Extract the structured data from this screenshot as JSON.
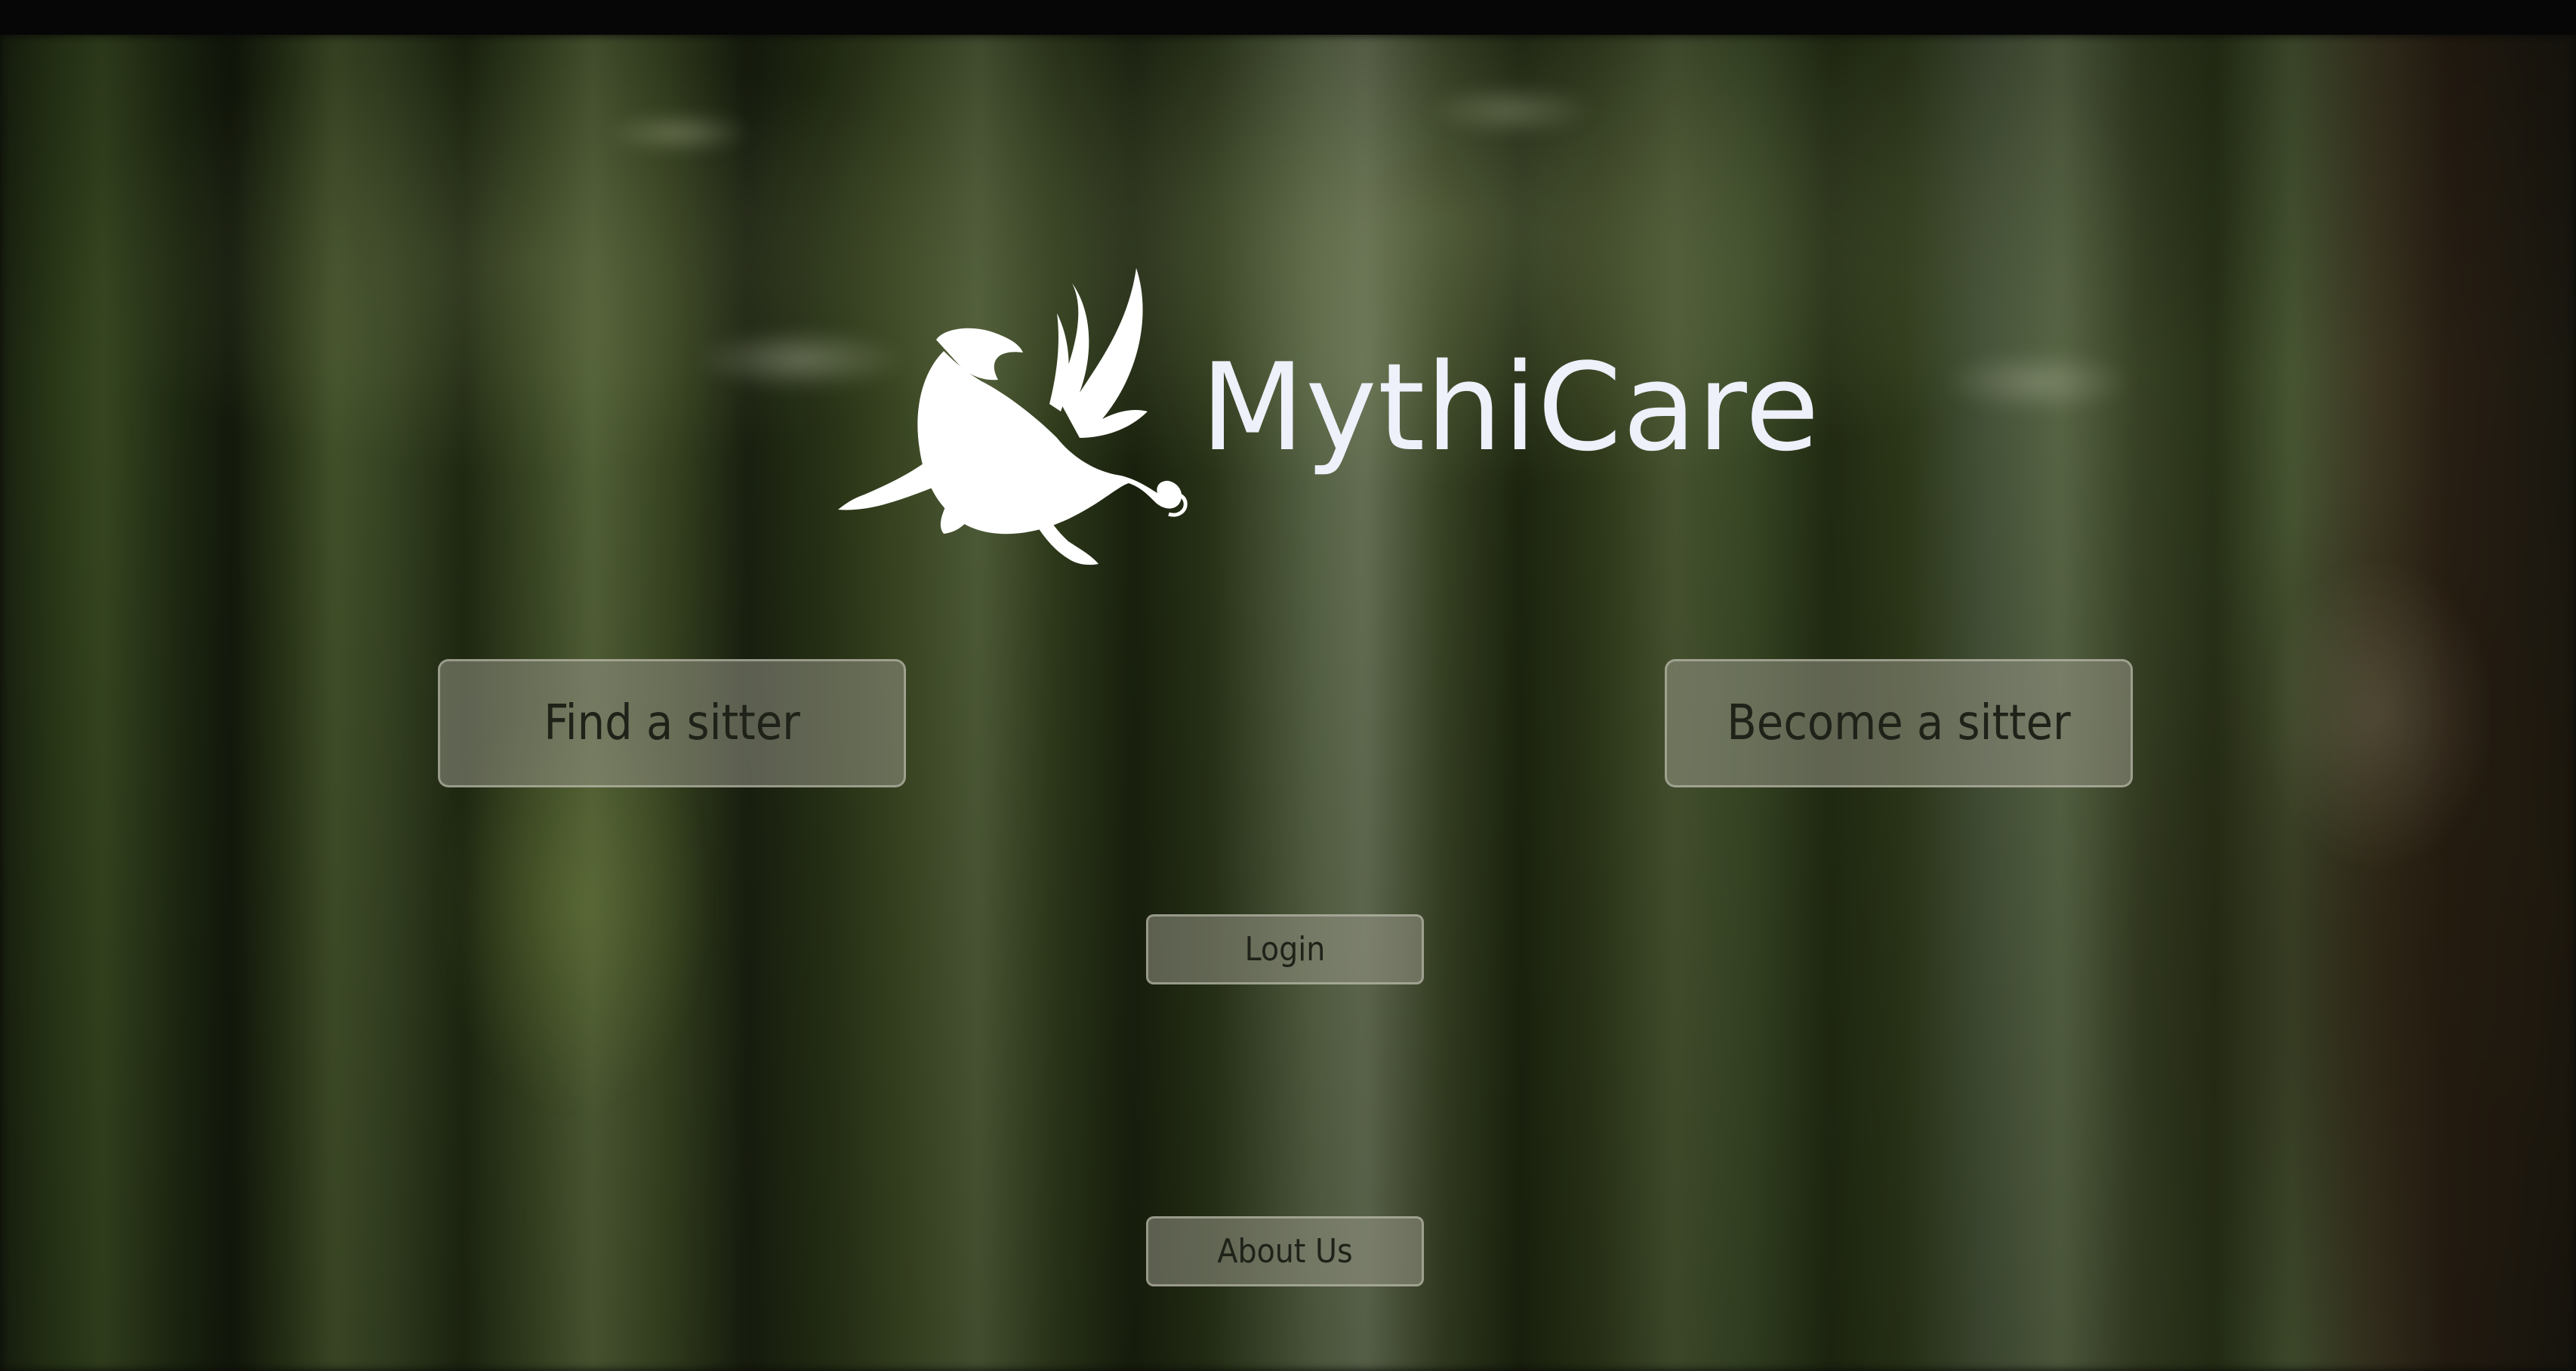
{
  "brand": {
    "name": "MythiCare",
    "logo_icon": "griffin-icon",
    "text_color": "#eef0fa"
  },
  "actions": {
    "find_sitter_label": "Find a sitter",
    "become_sitter_label": "Become a sitter",
    "login_label": "Login",
    "about_label": "About Us"
  },
  "background": {
    "image_icon": "forest-background"
  }
}
